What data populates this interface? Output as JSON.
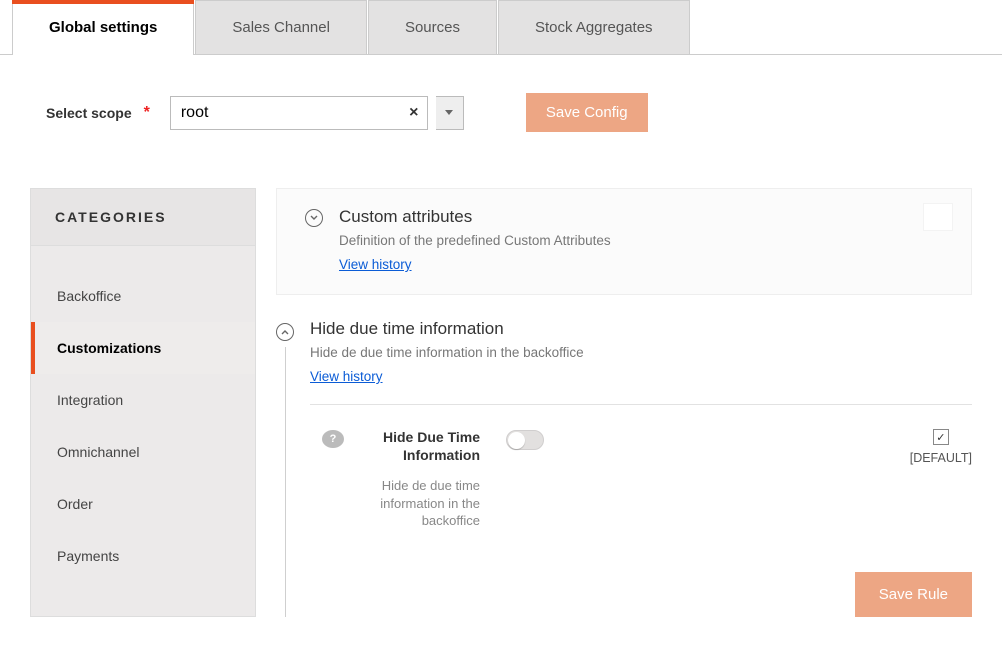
{
  "tabs": [
    "Global settings",
    "Sales Channel",
    "Sources",
    "Stock Aggregates"
  ],
  "active_tab": 0,
  "scope": {
    "label": "Select scope",
    "value": "root",
    "required": true
  },
  "save_config_label": "Save Config",
  "sidebar": {
    "heading": "CATEGORIES",
    "items": [
      "Backoffice",
      "Customizations",
      "Integration",
      "Omnichannel",
      "Order",
      "Payments"
    ],
    "active": 1
  },
  "card1": {
    "title": "Custom attributes",
    "desc": "Definition of the predefined Custom Attributes",
    "history": "View history"
  },
  "section2": {
    "title": "Hide due time information",
    "desc": "Hide de due time information in the backoffice",
    "history": "View history",
    "field_label": "Hide Due Time Information",
    "field_help": "Hide de due time information in the backoffice",
    "toggle": false,
    "default_checked": true,
    "default_label": "[DEFAULT]"
  },
  "save_rule_label": "Save Rule"
}
